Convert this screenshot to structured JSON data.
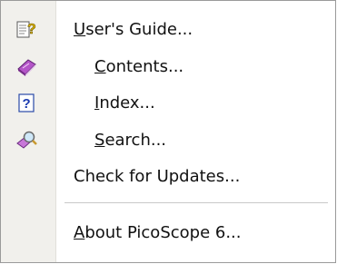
{
  "menu": {
    "items": [
      {
        "key": "U",
        "rest": "ser's Guide...",
        "icon": "help-book-question-icon"
      },
      {
        "key": "C",
        "rest": "ontents...",
        "icon": "contents-book-icon"
      },
      {
        "key": "I",
        "rest": "ndex...",
        "icon": "index-question-icon"
      },
      {
        "key": "S",
        "rest": "earch...",
        "icon": "search-magnifier-icon"
      },
      {
        "pre": "Check for Updates..."
      },
      {
        "key": "A",
        "rest": "bout PicoScope 6..."
      }
    ]
  }
}
